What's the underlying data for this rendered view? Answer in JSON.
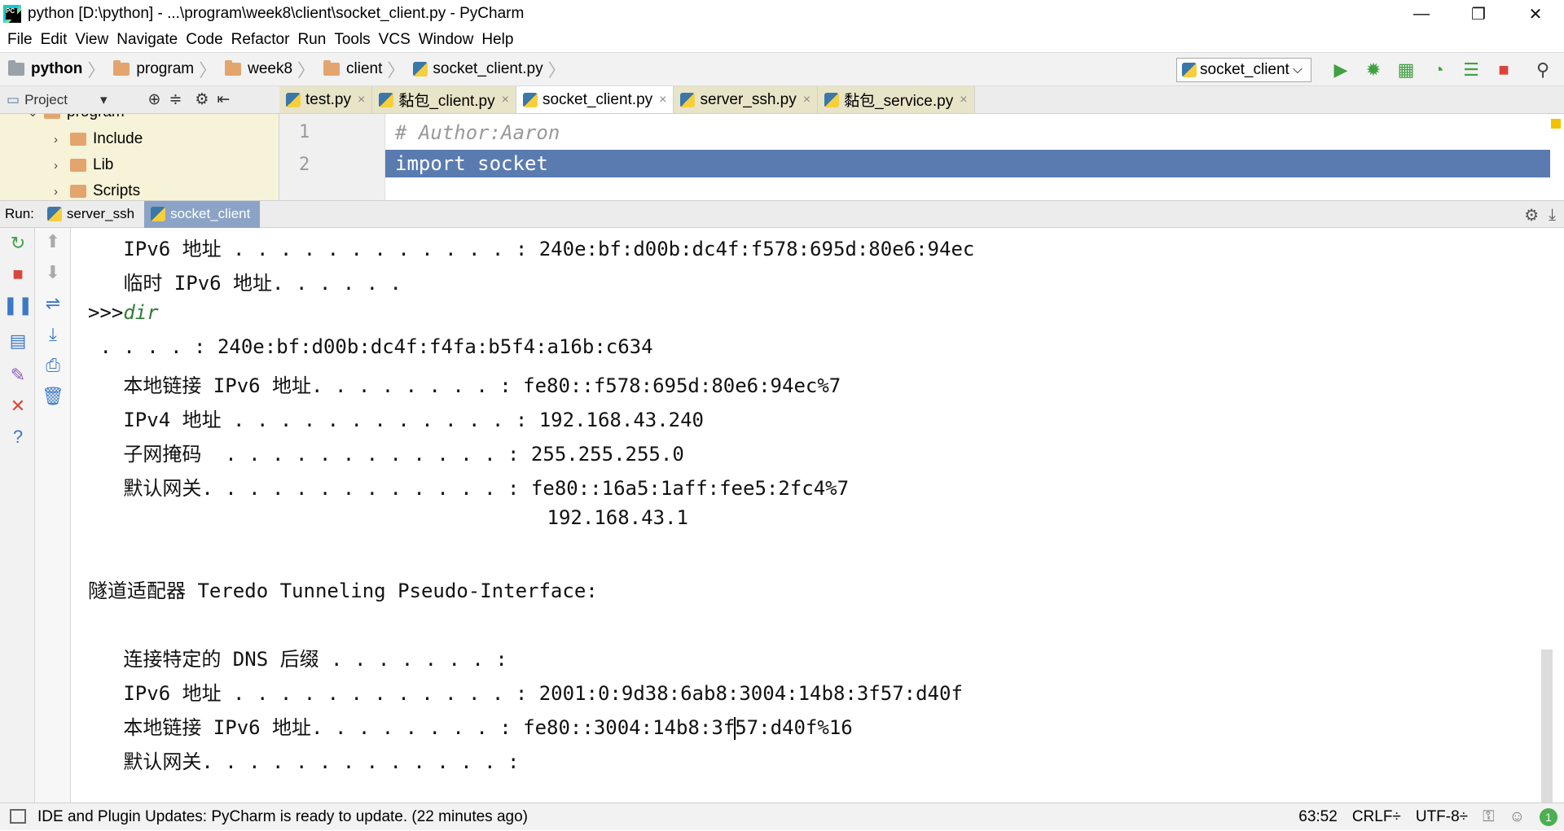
{
  "window": {
    "title": "python [D:\\python] - ...\\program\\week8\\client\\socket_client.py - PyCharm",
    "minimize": "—",
    "restore": "❐",
    "close": "✕"
  },
  "menu": [
    "File",
    "Edit",
    "View",
    "Navigate",
    "Code",
    "Refactor",
    "Run",
    "Tools",
    "VCS",
    "Window",
    "Help"
  ],
  "breadcrumb": [
    "python",
    "program",
    "week8",
    "client",
    "socket_client.py"
  ],
  "run_config": {
    "selected": "socket_client",
    "arrow": "⌵"
  },
  "project_panel": {
    "label": "Project",
    "arrow": "▾"
  },
  "editor_tabs": [
    {
      "label": "test.py",
      "close": "×"
    },
    {
      "label": "黏包_client.py",
      "close": "×"
    },
    {
      "label": "socket_client.py",
      "close": "×"
    },
    {
      "label": "server_ssh.py",
      "close": "×"
    },
    {
      "label": "黏包_service.py",
      "close": "×"
    }
  ],
  "tree": [
    {
      "label": "program",
      "arrow": "⌄"
    },
    {
      "label": "Include",
      "arrow": "›"
    },
    {
      "label": "Lib",
      "arrow": "›"
    },
    {
      "label": "Scripts",
      "arrow": "›"
    }
  ],
  "editor": {
    "lines": [
      {
        "num": "1",
        "text": "# Author:Aaron"
      },
      {
        "num": "2",
        "text": "import socket"
      }
    ]
  },
  "run_panel": {
    "label": "Run:",
    "tabs": [
      "server_ssh",
      "socket_client"
    ]
  },
  "console": {
    "lines": [
      "   IPv6 地址 . . . . . . . . . . . . : 240e:bf:d00b:dc4f:f578:695d:80e6:94ec",
      "   临时 IPv6 地址. . . . . .",
      ">>>",
      " . . . . : 240e:bf:d00b:dc4f:f4fa:b5f4:a16b:c634",
      "   本地链接 IPv6 地址. . . . . . . . : fe80::f578:695d:80e6:94ec%7",
      "   IPv4 地址 . . . . . . . . . . . . : 192.168.43.240",
      "   子网掩码  . . . . . . . . . . . . : 255.255.255.0",
      "   默认网关. . . . . . . . . . . . . : fe80::16a5:1aff:fee5:2fc4%7",
      "                                       192.168.43.1",
      "",
      "隧道适配器 Teredo Tunneling Pseudo-Interface:",
      "",
      "   连接特定的 DNS 后缀 . . . . . . . :",
      "   IPv6 地址 . . . . . . . . . . . . : 2001:0:9d38:6ab8:3004:14b8:3f57:d40f",
      "   本地链接 IPv6 地址. . . . . . . . : fe80::3004:14b8:3f",
      "   默认网关. . . . . . . . . . . . . :"
    ],
    "prompt_command": "dir",
    "caret_tail": "57:d40f%16"
  },
  "status": {
    "message": "IDE and Plugin Updates: PyCharm is ready to update. (22 minutes ago)",
    "position": "63:52",
    "line_sep": "CRLF÷",
    "encoding": "UTF-8÷",
    "notifications": "1"
  },
  "colors": {
    "selection": "#5a7bb0",
    "tree_bg": "#f6f3d8",
    "tab_bg": "#e8e4c8",
    "run_tab_active": "#8ba3c6",
    "prompt_green": "#2e7d32"
  }
}
